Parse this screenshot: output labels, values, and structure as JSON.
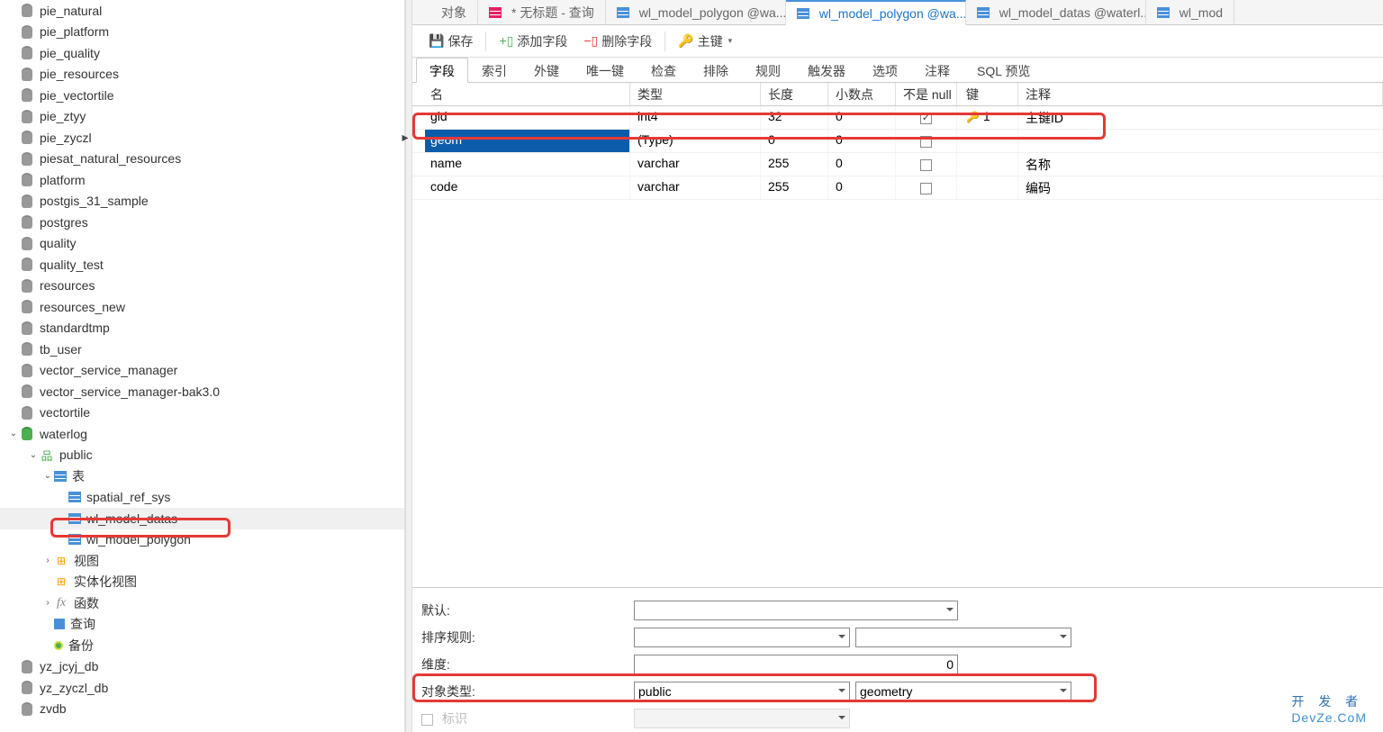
{
  "sidebar": {
    "dbs": [
      "pie_natural",
      "pie_platform",
      "pie_quality",
      "pie_resources",
      "pie_vectortile",
      "pie_ztyy",
      "pie_zyczl",
      "piesat_natural_resources",
      "platform",
      "postgis_31_sample",
      "postgres",
      "quality",
      "quality_test",
      "resources",
      "resources_new",
      "standardtmp",
      "tb_user",
      "vector_service_manager",
      "vector_service_manager-bak3.0",
      "vectortile"
    ],
    "activeDb": "waterlog",
    "schema": "public",
    "tablesLabel": "表",
    "tables": [
      "spatial_ref_sys",
      "wl_model_datas",
      "wl_model_polygon"
    ],
    "selectedTable": "wl_model_datas",
    "viewsLabel": "视图",
    "matViewsLabel": "实体化视图",
    "funcLabel": "函数",
    "queryLabel": "查询",
    "backupLabel": "备份",
    "tailDbs": [
      "yz_jcyj_db",
      "yz_zyczl_db",
      "zvdb"
    ]
  },
  "topTabs": [
    {
      "label": "对象",
      "type": "obj"
    },
    {
      "label": "* 无标题 - 查询",
      "type": "query"
    },
    {
      "label": "wl_model_polygon @wa...",
      "type": "table"
    },
    {
      "label": "wl_model_polygon @wa...",
      "type": "design",
      "active": true
    },
    {
      "label": "wl_model_datas @waterl...",
      "type": "table"
    },
    {
      "label": "wl_mod",
      "type": "table"
    }
  ],
  "toolbar": {
    "save": "保存",
    "addField": "添加字段",
    "delField": "删除字段",
    "pkey": "主键"
  },
  "fieldTabs": [
    "字段",
    "索引",
    "外键",
    "唯一键",
    "检查",
    "排除",
    "规则",
    "触发器",
    "选项",
    "注释",
    "SQL 预览"
  ],
  "activeFieldTab": "字段",
  "gridHeaders": {
    "name": "名",
    "type": "类型",
    "len": "长度",
    "dec": "小数点",
    "null": "不是 null",
    "key": "键",
    "comment": "注释"
  },
  "gridRows": [
    {
      "name": "gid",
      "type": "int4",
      "len": "32",
      "dec": "0",
      "null": true,
      "key": "1",
      "comment": "主键ID"
    },
    {
      "name": "geom",
      "type": "(Type)",
      "len": "0",
      "dec": "0",
      "null": false,
      "key": "",
      "comment": "",
      "selected": true
    },
    {
      "name": "name",
      "type": "varchar",
      "len": "255",
      "dec": "0",
      "null": false,
      "key": "",
      "comment": "名称"
    },
    {
      "name": "code",
      "type": "varchar",
      "len": "255",
      "dec": "0",
      "null": false,
      "key": "",
      "comment": "编码"
    }
  ],
  "props": {
    "defaultLabel": "默认:",
    "defaultVal": "",
    "collationLabel": "排序规则:",
    "collationA": "",
    "collationB": "",
    "dimLabel": "维度:",
    "dimVal": "0",
    "objTypeLabel": "对象类型:",
    "schemaVal": "public",
    "typeVal": "geometry",
    "flagLabel": "标识"
  },
  "watermark": {
    "t": "开 发 者",
    "b": "DevZe.CoM"
  }
}
